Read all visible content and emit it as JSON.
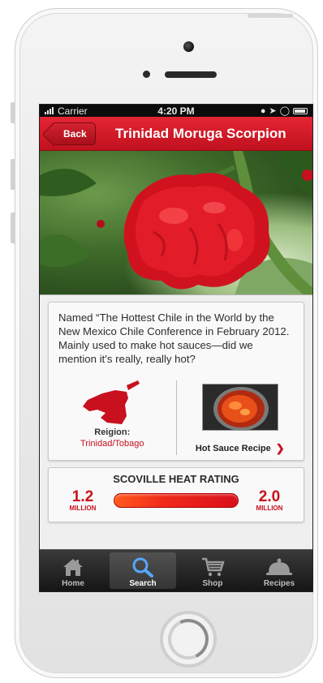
{
  "status_bar": {
    "carrier": "Carrier",
    "time": "4:20 PM"
  },
  "nav": {
    "back_label": "Back",
    "title": "Trinidad Moruga Scorpion"
  },
  "description": "Named “The Hottest Chile in the World by the New Mexico Chile Conference in February 2012. Mainly used to make hot sauces—did we mention it’s really, really hot?",
  "region": {
    "label": "Reigion:",
    "value": "Trinidad/Tobago"
  },
  "recipe": {
    "label": "Hot Sauce Recipe"
  },
  "heat": {
    "title": "SCOVILLE HEAT RATING",
    "min_value": "1.2",
    "min_unit": "MILLION",
    "max_value": "2.0",
    "max_unit": "MILLION"
  },
  "tabs": [
    {
      "label": "Home",
      "icon": "home-icon"
    },
    {
      "label": "Search",
      "icon": "search-icon",
      "active": true
    },
    {
      "label": "Shop",
      "icon": "cart-icon"
    },
    {
      "label": "Recipes",
      "icon": "cloche-icon"
    }
  ],
  "colors": {
    "accent": "#c8101e",
    "nav": "#d81c2a",
    "tab_bar": "#1f1f1f"
  }
}
